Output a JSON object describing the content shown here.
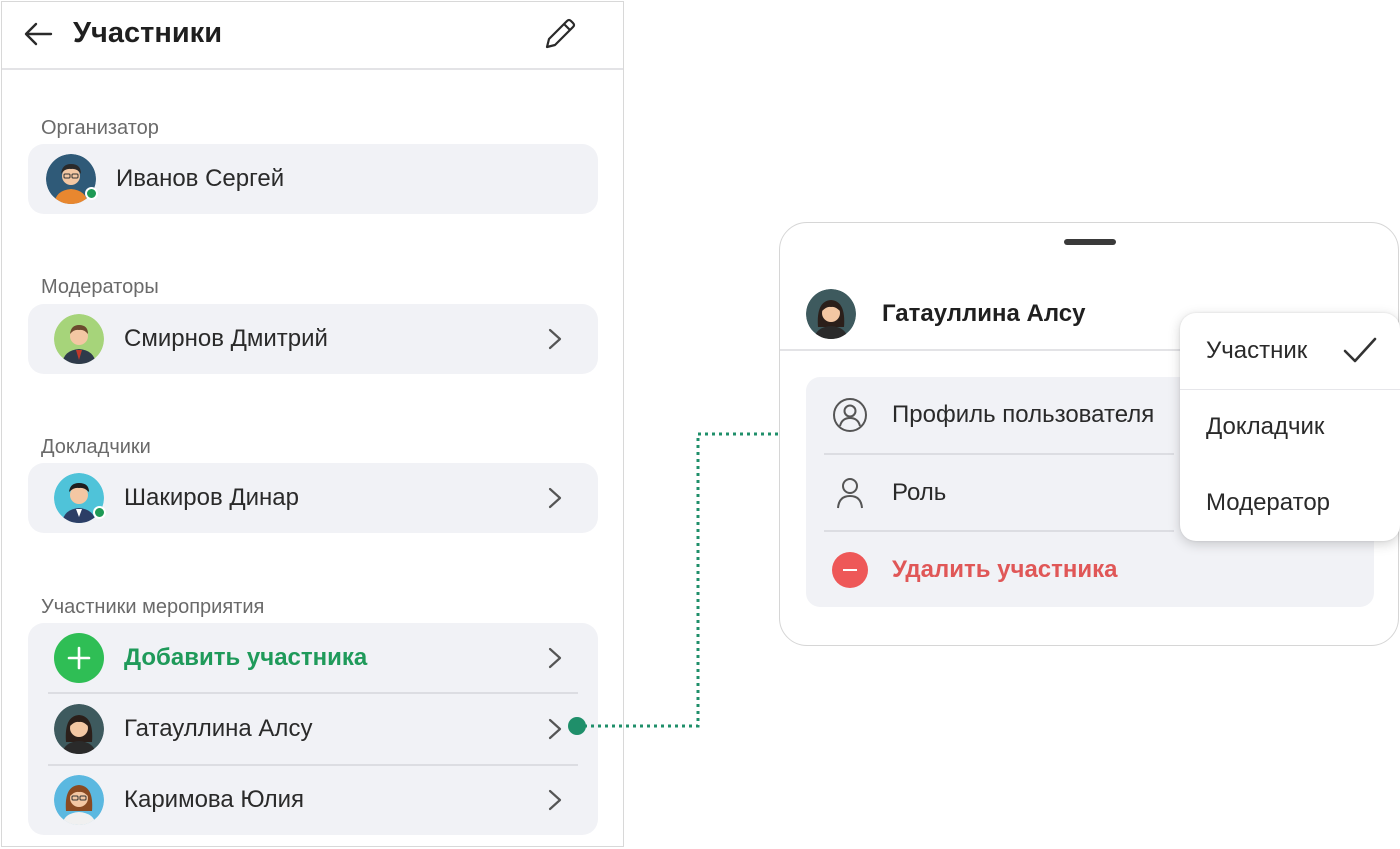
{
  "header": {
    "title": "Участники"
  },
  "sections": {
    "organizer": {
      "label": "Организатор",
      "members": [
        {
          "name": "Иванов Сергей",
          "online": true
        }
      ]
    },
    "moderators": {
      "label": "Модераторы",
      "members": [
        {
          "name": "Смирнов Дмитрий",
          "online": false
        }
      ]
    },
    "speakers": {
      "label": "Докладчики",
      "members": [
        {
          "name": "Шакиров Динар",
          "online": true
        }
      ]
    },
    "participants": {
      "label": "Участники мероприятия",
      "add_label": "Добавить участника",
      "members": [
        {
          "name": "Гатауллина Алсу",
          "online": false
        },
        {
          "name": "Каримова Юлия",
          "online": false
        }
      ]
    }
  },
  "sheet": {
    "member_name": "Гатауллина Алсу",
    "actions": [
      {
        "label": "Профиль пользователя",
        "icon": "profile-circle-icon"
      },
      {
        "label": "Роль",
        "icon": "person-icon"
      },
      {
        "label": "Удалить участника",
        "icon": "remove-icon"
      }
    ],
    "role_options": [
      {
        "label": "Участник",
        "selected": true
      },
      {
        "label": "Докладчик",
        "selected": false
      },
      {
        "label": "Модератор",
        "selected": false
      }
    ]
  },
  "colors": {
    "accent_green": "#1f9a5a",
    "add_button": "#2fbe55",
    "danger": "#e05757",
    "card_bg": "#f1f2f6",
    "connector": "#1f8f6a"
  }
}
